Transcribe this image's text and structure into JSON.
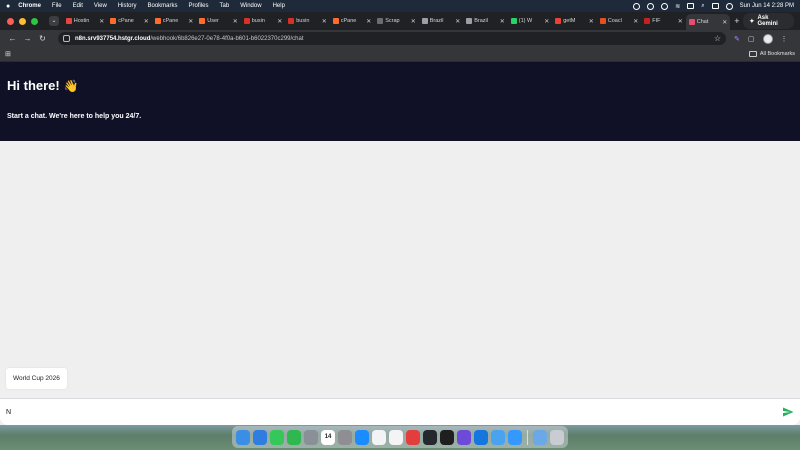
{
  "menubar": {
    "app_name": "Chrome",
    "items": [
      "File",
      "Edit",
      "View",
      "History",
      "Bookmarks",
      "Profiles",
      "Tab",
      "Window",
      "Help"
    ],
    "datetime": "Sun Jun 14  2:28 PM"
  },
  "tabs": [
    {
      "label": "Hostin",
      "color": "#e8453c"
    },
    {
      "label": "cPane",
      "color": "#ff6c2c"
    },
    {
      "label": "cPane",
      "color": "#ff6c2c"
    },
    {
      "label": "User",
      "color": "#ff6c2c"
    },
    {
      "label": "busin",
      "color": "#d93025"
    },
    {
      "label": "busin",
      "color": "#d93025"
    },
    {
      "label": "cPane",
      "color": "#ff6c2c"
    },
    {
      "label": "Scrap",
      "color": "#6c6c6c"
    },
    {
      "label": "Brazil",
      "color": "#9aa0a6"
    },
    {
      "label": "Brazil",
      "color": "#9aa0a6"
    },
    {
      "label": "(1) W",
      "color": "#25d366"
    },
    {
      "label": "getM",
      "color": "#ea4335"
    },
    {
      "label": "Coacl",
      "color": "#e6501e"
    },
    {
      "label": "FIF",
      "color": "#c5221f"
    },
    {
      "label": "Chat",
      "color": "#ea4b71",
      "active": true
    }
  ],
  "ask_gemini": "Ask Gemini",
  "address": {
    "host": "n8n.srv937754.hstgr.cloud",
    "path": "/webhook/6b826e27-0e78-4f0a-b601-b6022370c299/chat"
  },
  "bookmarks": {
    "all_bookmarks_label": "All Bookmarks"
  },
  "chat": {
    "title": "Hi there!",
    "title_emoji": "👋",
    "subtitle": "Start a chat. We're here to help you 24/7.",
    "suggestion": "World Cup 2026",
    "input_value": "N",
    "accent_color": "#27ae60",
    "header_bg": "#101127"
  },
  "dock": {
    "apps": [
      {
        "name": "finder-icon",
        "color": "#3a8ee6",
        "glyph": ""
      },
      {
        "name": "safari-icon",
        "color": "#2f7de1",
        "glyph": ""
      },
      {
        "name": "messages-icon",
        "color": "#35c759",
        "glyph": ""
      },
      {
        "name": "facetime-icon",
        "color": "#2fb84f",
        "glyph": ""
      },
      {
        "name": "launchpad-icon",
        "color": "#8a8f98",
        "glyph": ""
      },
      {
        "name": "calendar-icon",
        "color": "#ffffff",
        "glyph": "14"
      },
      {
        "name": "settings-icon",
        "color": "#8e8e93",
        "glyph": ""
      },
      {
        "name": "app-store-icon",
        "color": "#1a8cff",
        "glyph": ""
      },
      {
        "name": "chrome-icon",
        "color": "#f1f3f4",
        "glyph": ""
      },
      {
        "name": "textedit-icon",
        "color": "#f4f4f4",
        "glyph": ""
      },
      {
        "name": "pen-icon",
        "color": "#e33d3d",
        "glyph": ""
      },
      {
        "name": "github-icon",
        "color": "#24292e",
        "glyph": ""
      },
      {
        "name": "cursor-icon",
        "color": "#1f1f1f",
        "glyph": ""
      },
      {
        "name": "app-icon",
        "color": "#6e4ad8",
        "glyph": ""
      },
      {
        "name": "xcode-icon",
        "color": "#1576e0",
        "glyph": ""
      },
      {
        "name": "screen-icon",
        "color": "#4aa3ee",
        "glyph": ""
      },
      {
        "name": "vpn-icon",
        "color": "#3399ff",
        "glyph": ""
      },
      {
        "name": "applications-folder-icon",
        "color": "#6aa8e8",
        "glyph": ""
      },
      {
        "name": "trash-icon",
        "color": "#c9ccd0",
        "glyph": ""
      }
    ]
  }
}
